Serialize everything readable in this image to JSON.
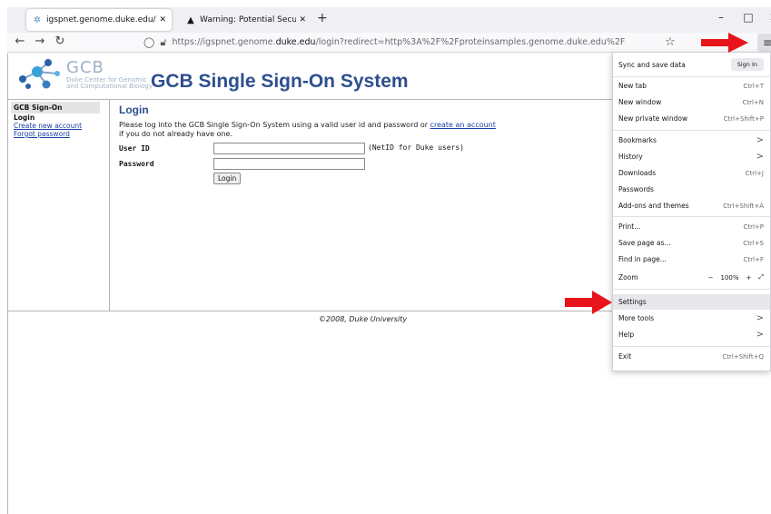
{
  "browser": {
    "tabs": [
      {
        "title": "igspnet.genome.duke.edu/login",
        "favicon": "gcb-favicon",
        "active": true
      },
      {
        "title": "Warning: Potential Security Risk",
        "favicon": "warning-icon",
        "active": false
      }
    ],
    "new_tab": "+",
    "url_prefix": "https://igspnet.genome.",
    "url_domain": "duke.edu",
    "url_suffix": "/login?redirect=http%3A%2F%2Fproteinsamples.genome.duke.edu%2F"
  },
  "site": {
    "logo_big": "GCB",
    "logo_sub_1": "Duke Center for Genomic",
    "logo_sub_2": "and Computational Biology",
    "title": "GCB Single Sign-On System"
  },
  "sidebar": {
    "heading": "GCB Sign-On",
    "items": [
      {
        "label": "Login"
      },
      {
        "label": "Create new account"
      },
      {
        "label": "Forgot password"
      }
    ]
  },
  "main": {
    "heading": "Login",
    "intro_text": "Please log into the GCB Single Sign-On System using a valid user id and password or ",
    "intro_link": "create an account",
    "intro_text_2": "if you do not already have one.",
    "userid_label": "User ID",
    "userid_value": "",
    "userid_hint": "(NetID for Duke users)",
    "password_label": "Password",
    "password_value": "",
    "login_button": "Login"
  },
  "footer": "©2008, Duke University",
  "menu": {
    "sync": "Sync and save data",
    "sign_in": "Sign In",
    "items": [
      {
        "label": "New tab",
        "shortcut": "Ctrl+T"
      },
      {
        "label": "New window",
        "shortcut": "Ctrl+N"
      },
      {
        "label": "New private window",
        "shortcut": "Ctrl+Shift+P"
      },
      {
        "label": "Bookmarks",
        "shortcut": ">"
      },
      {
        "label": "History",
        "shortcut": ">"
      },
      {
        "label": "Downloads",
        "shortcut": "Ctrl+J"
      },
      {
        "label": "Passwords",
        "shortcut": ""
      },
      {
        "label": "Add-ons and themes",
        "shortcut": "Ctrl+Shift+A"
      },
      {
        "label": "Print...",
        "shortcut": "Ctrl+P"
      },
      {
        "label": "Save page as...",
        "shortcut": "Ctrl+S"
      },
      {
        "label": "Find in page...",
        "shortcut": "Ctrl+F"
      },
      {
        "label": "Zoom",
        "shortcut": ""
      },
      {
        "label": "Settings",
        "shortcut": ""
      },
      {
        "label": "More tools",
        "shortcut": ">"
      },
      {
        "label": "Help",
        "shortcut": ">"
      },
      {
        "label": "Exit",
        "shortcut": "Ctrl+Shift+Q"
      }
    ],
    "zoom_minus": "−",
    "zoom_level": "100%",
    "zoom_plus": "+"
  },
  "colors": {
    "title_blue": "#2d4f8e",
    "link_blue": "#1a3ea8",
    "arrow_red": "#e8141b"
  }
}
